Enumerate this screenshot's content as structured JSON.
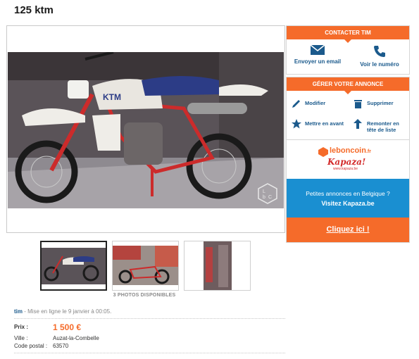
{
  "listing": {
    "title": "125 ktm",
    "photos_count_label": "3 PHOTOS DISPONIBLES",
    "seller": "tim",
    "posted": " - Mise en ligne le 9 janvier à 00:05."
  },
  "details": {
    "price_label": "Prix :",
    "price_value": "1 500 €",
    "city_label": "Ville :",
    "city_value": "Auzat-la-Combelle",
    "postal_label": "Code postal :",
    "postal_value": "63570"
  },
  "contact_panel": {
    "header": "CONTACTER TIM",
    "email_label": "Envoyer un email",
    "phone_label": "Voir le numéro"
  },
  "manage_panel": {
    "header": "GÉRER VOTRE ANNONCE",
    "edit": "Modifier",
    "delete": "Supprimer",
    "feature": "Mettre en avant",
    "bump_line1": "Remonter en",
    "bump_line2": "tête de liste"
  },
  "ad": {
    "brand1": "leboncoin",
    "brand1_suffix": ".fr",
    "brand2": "Kapaza!",
    "brand2_sub": "www.kapaza.be",
    "line1": "Petites annonces en Belgique ?",
    "line2": "Visitez Kapaza.be",
    "cta": "Cliquez ici !"
  },
  "colors": {
    "accent": "#f56b2a",
    "link": "#1b5a8c",
    "ad_blue": "#1a8fd1"
  },
  "icons": [
    "email-icon",
    "phone-icon",
    "pencil-icon",
    "trash-icon",
    "star-icon",
    "arrow-up-icon",
    "camera-badge-icon"
  ]
}
